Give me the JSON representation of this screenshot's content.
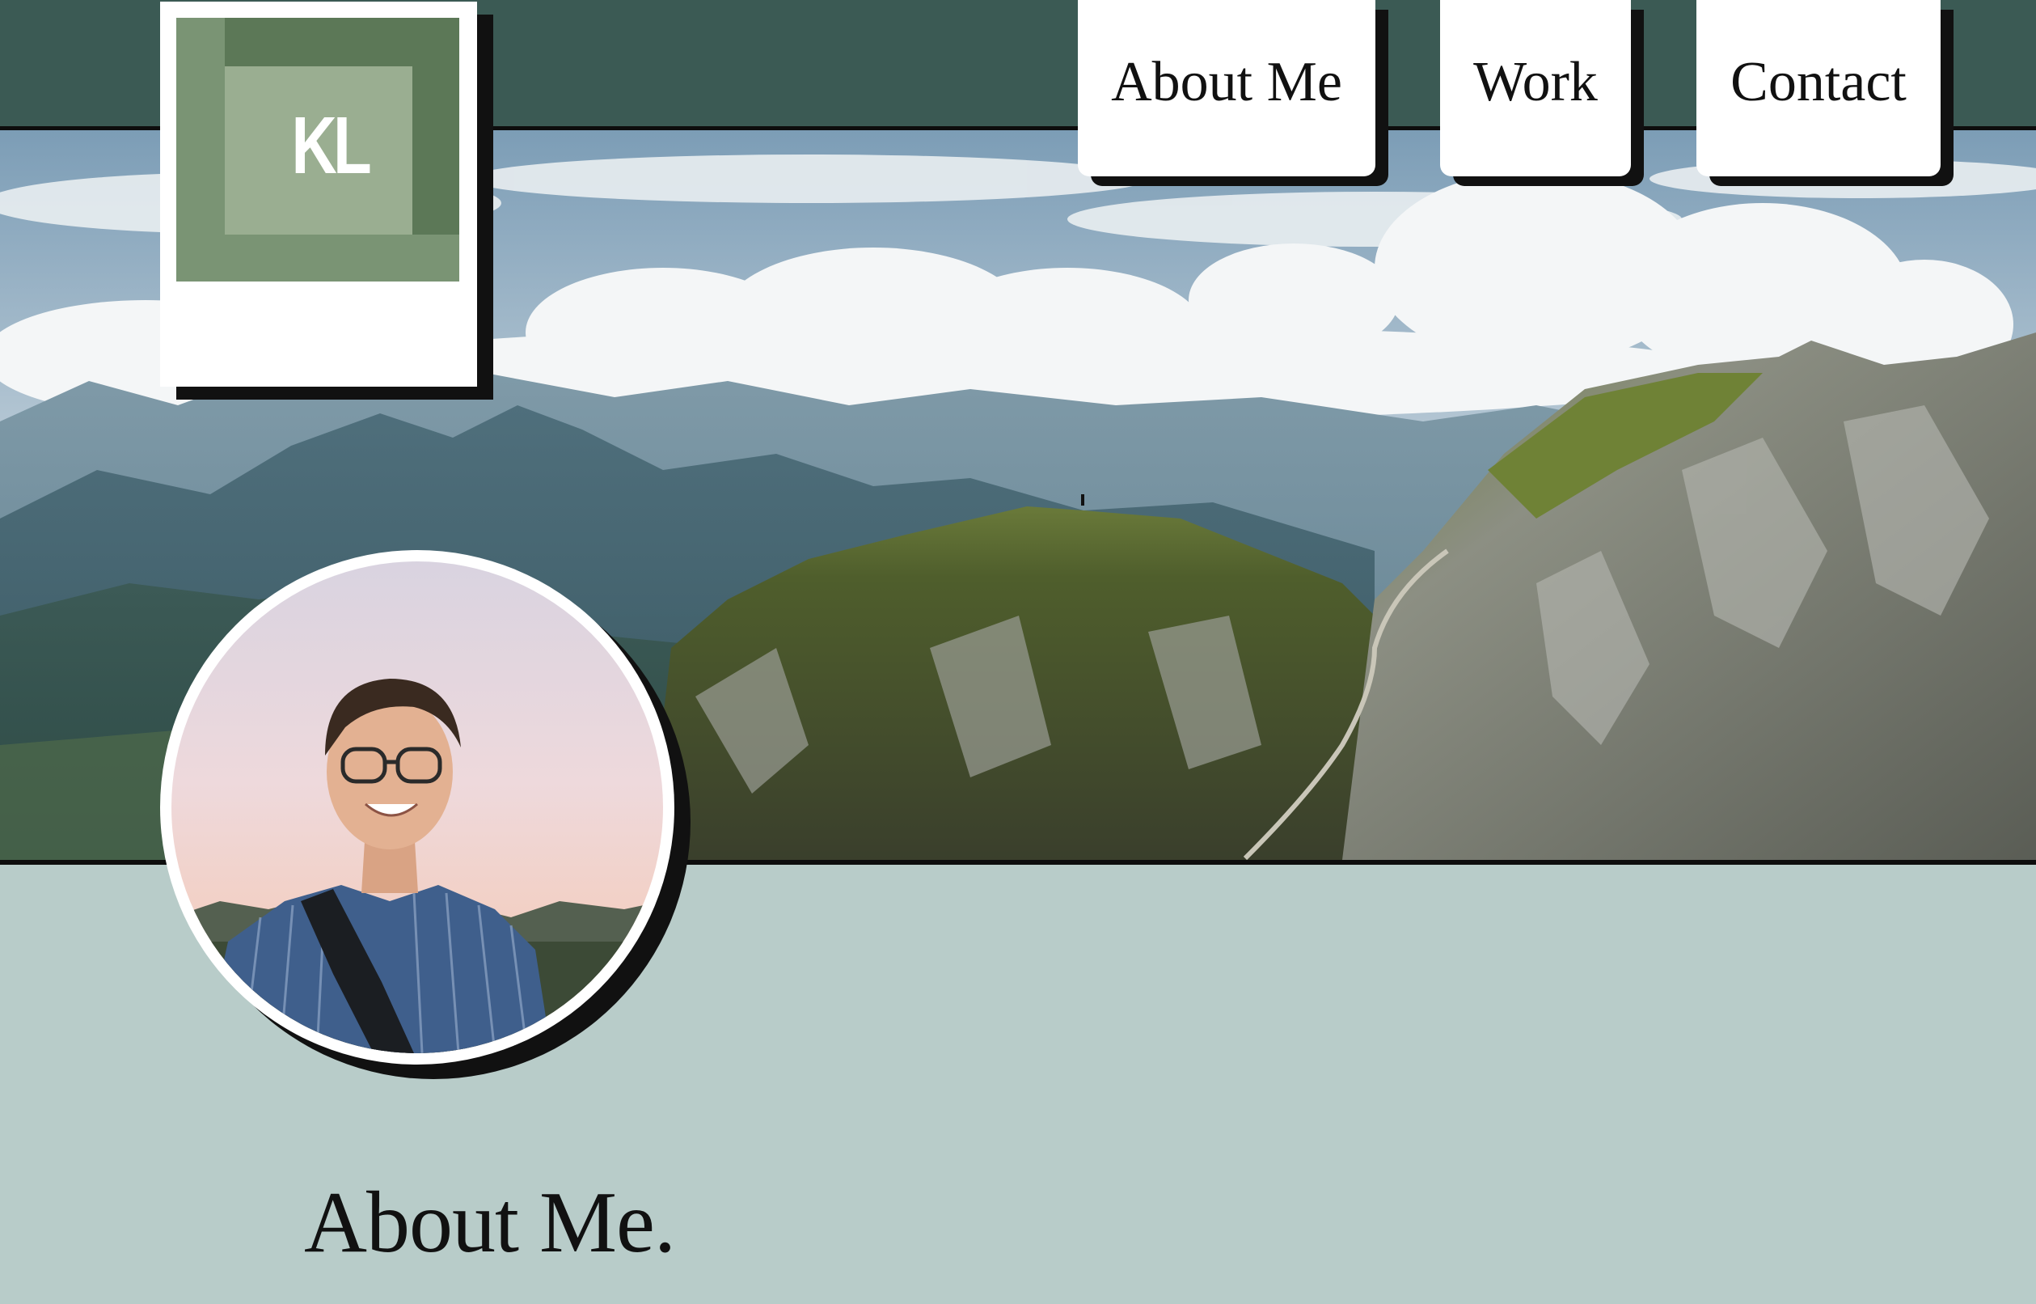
{
  "logo": {
    "initials": "KL",
    "colors": {
      "outer": "#7a9474",
      "dark": "#5c7857",
      "inner": "#9aae91"
    }
  },
  "nav": {
    "items": [
      {
        "label": "About Me"
      },
      {
        "label": "Work"
      },
      {
        "label": "Contact"
      }
    ]
  },
  "hero": {
    "image": "mountain-landscape"
  },
  "profile": {
    "image": "profile-photo"
  },
  "section": {
    "title": "About Me."
  },
  "colors": {
    "header": "#3b5a54",
    "background": "#b8ccc9",
    "card": "#ffffff",
    "shadow": "#111111"
  }
}
